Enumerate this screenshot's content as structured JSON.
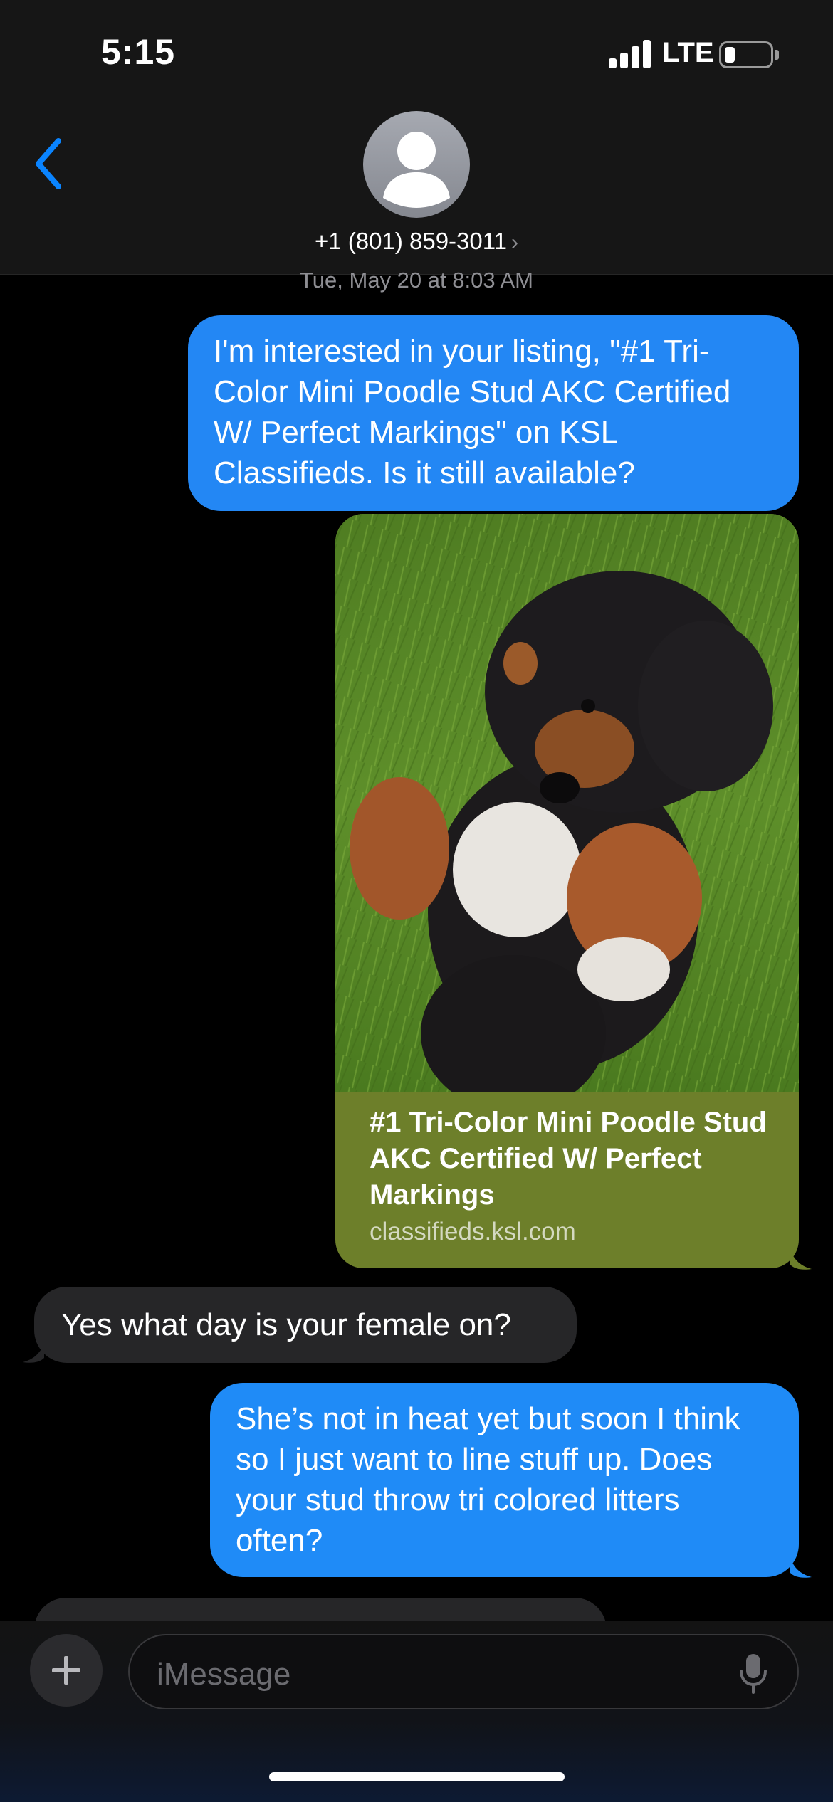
{
  "status_bar": {
    "time": "5:15",
    "network": "LTE",
    "signal_bars": 4,
    "battery_level": 0.15
  },
  "header": {
    "back_icon": "chevron-left-icon",
    "contact_number": "+1 (801) 859-3011",
    "contact_chevron": "›"
  },
  "thread": {
    "timestamp": "Tue, May 20 at 8:03 AM",
    "messages": [
      {
        "direction": "sent",
        "text": "I'm interested in your listing, \"#1 Tri-Color Mini Poodle Stud AKC Certified W/ Perfect Markings\" on KSL Classifieds. Is it still available?"
      },
      {
        "direction": "sent",
        "type": "link-preview",
        "title": "#1 Tri-Color Mini Poodle Stud AKC Certified W/ Perfect Markings",
        "domain": "classifieds.ksl.com",
        "image": "poodle-photo"
      },
      {
        "direction": "received",
        "text": "Yes what day is your female on?"
      },
      {
        "direction": "sent",
        "text": "She’s not in heat yet but soon I think so I just want to line stuff up. Does your stud throw tri colored litters often?"
      }
    ]
  },
  "composer": {
    "placeholder": "iMessage",
    "plus_icon": "plus-icon",
    "mic_icon": "microphone-icon"
  },
  "colors": {
    "sent_bubble": "#1f8bf7",
    "received_bubble": "#262628",
    "link_card": "#6d7f2a",
    "accent": "#0a84ff"
  }
}
